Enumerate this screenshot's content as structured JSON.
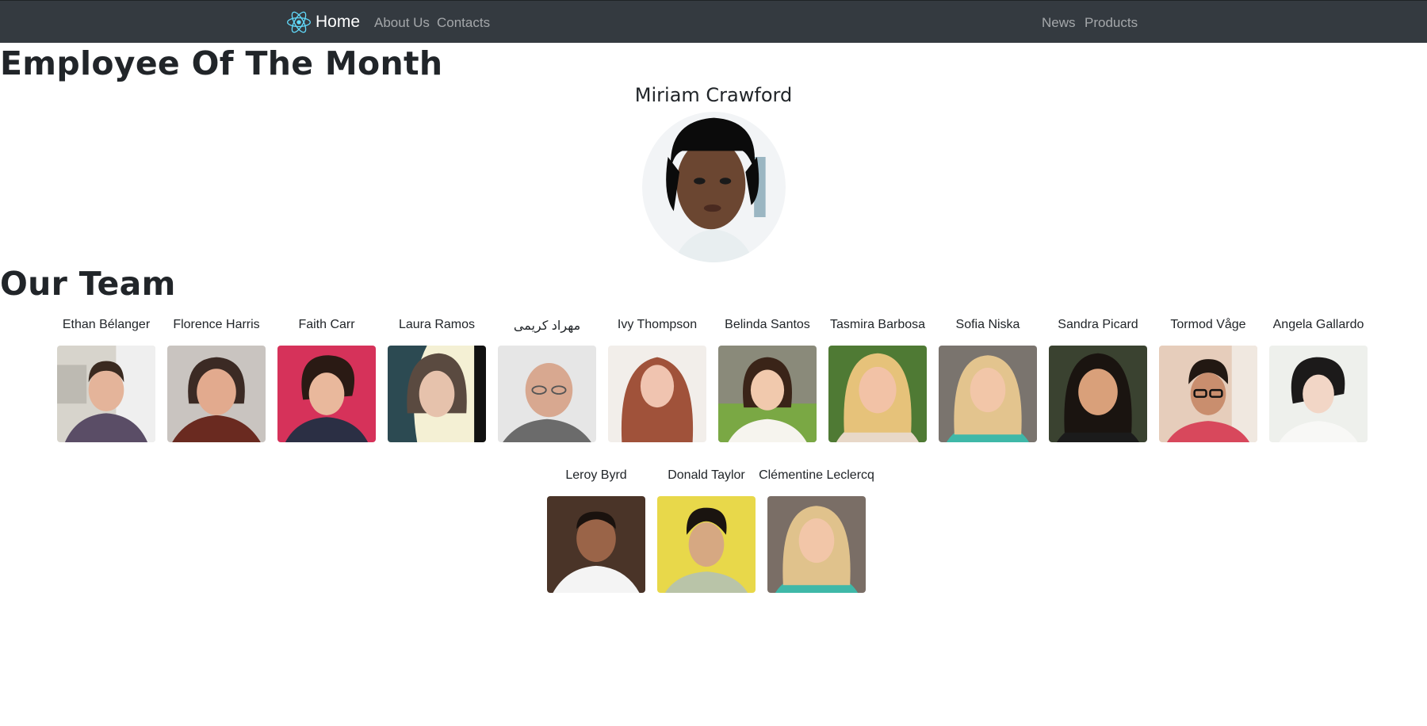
{
  "navbar": {
    "brand_label": "Home",
    "left_links": [
      "About Us",
      "Contacts"
    ],
    "right_links": [
      "News",
      "Products"
    ]
  },
  "employee_of_month": {
    "heading": "Employee Of The Month",
    "name": "Miriam Crawford"
  },
  "team": {
    "heading": "Our Team",
    "members": [
      {
        "name": "Ethan Bélanger"
      },
      {
        "name": "Florence Harris"
      },
      {
        "name": "Faith Carr"
      },
      {
        "name": "Laura Ramos"
      },
      {
        "name": "مهراد کریمی"
      },
      {
        "name": "Ivy Thompson"
      },
      {
        "name": "Belinda Santos"
      },
      {
        "name": "Tasmira Barbosa"
      },
      {
        "name": "Sofia Niska"
      },
      {
        "name": "Sandra Picard"
      },
      {
        "name": "Tormod Våge"
      },
      {
        "name": "Angela Gallardo"
      },
      {
        "name": "Leroy Byrd"
      },
      {
        "name": "Donald Taylor"
      },
      {
        "name": "Clémentine Leclercq"
      }
    ]
  },
  "colors": {
    "navbar_bg": "#343a40",
    "brand_icon": "#61dafb"
  }
}
